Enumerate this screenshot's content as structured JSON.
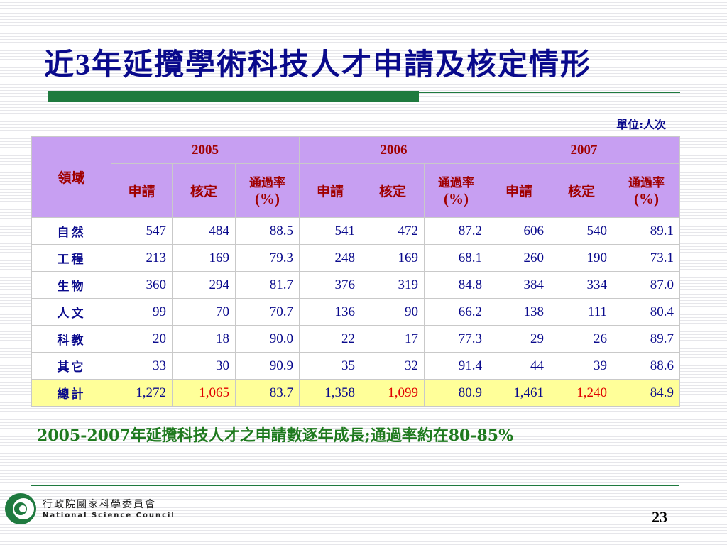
{
  "title_prefix": "近",
  "title_num": "3",
  "title_suffix": "年延攬學術科技人才申請及核定情形",
  "unit": "單位:人次",
  "table": {
    "field_header": "領域",
    "years": [
      "2005",
      "2006",
      "2007"
    ],
    "sub_apply": "申請",
    "sub_approve": "核定",
    "sub_rate_line1": "通過率",
    "sub_rate_line2": "(%)",
    "rows": [
      {
        "name": "自然",
        "v": [
          "547",
          "484",
          "88.5",
          "541",
          "472",
          "87.2",
          "606",
          "540",
          "89.1"
        ]
      },
      {
        "name": "工程",
        "v": [
          "213",
          "169",
          "79.3",
          "248",
          "169",
          "68.1",
          "260",
          "190",
          "73.1"
        ]
      },
      {
        "name": "生物",
        "v": [
          "360",
          "294",
          "81.7",
          "376",
          "319",
          "84.8",
          "384",
          "334",
          "87.0"
        ]
      },
      {
        "name": "人文",
        "v": [
          "99",
          "70",
          "70.7",
          "136",
          "90",
          "66.2",
          "138",
          "111",
          "80.4"
        ]
      },
      {
        "name": "科教",
        "v": [
          "20",
          "18",
          "90.0",
          "22",
          "17",
          "77.3",
          "29",
          "26",
          "89.7"
        ]
      },
      {
        "name": "其它",
        "v": [
          "33",
          "30",
          "90.9",
          "35",
          "32",
          "91.4",
          "44",
          "39",
          "88.6"
        ]
      }
    ],
    "total": {
      "name": "總計",
      "v": [
        "1,272",
        "1,065",
        "83.7",
        "1,358",
        "1,099",
        "80.9",
        "1,461",
        "1,240",
        "84.9"
      ]
    }
  },
  "summary": "2005-2007年延攬科技人才之申請數逐年成長;通過率約在80-85%",
  "logo": {
    "cn": "行政院國家科學委員會",
    "en": "National Science Council"
  },
  "page_number": "23",
  "colors": {
    "title": "#0a0a8c",
    "accent_green": "#1f7a3f",
    "header_bg": "#c79ff2",
    "header_text": "#a00000",
    "total_bg": "#ffff99",
    "approved_total": "#e00000"
  }
}
